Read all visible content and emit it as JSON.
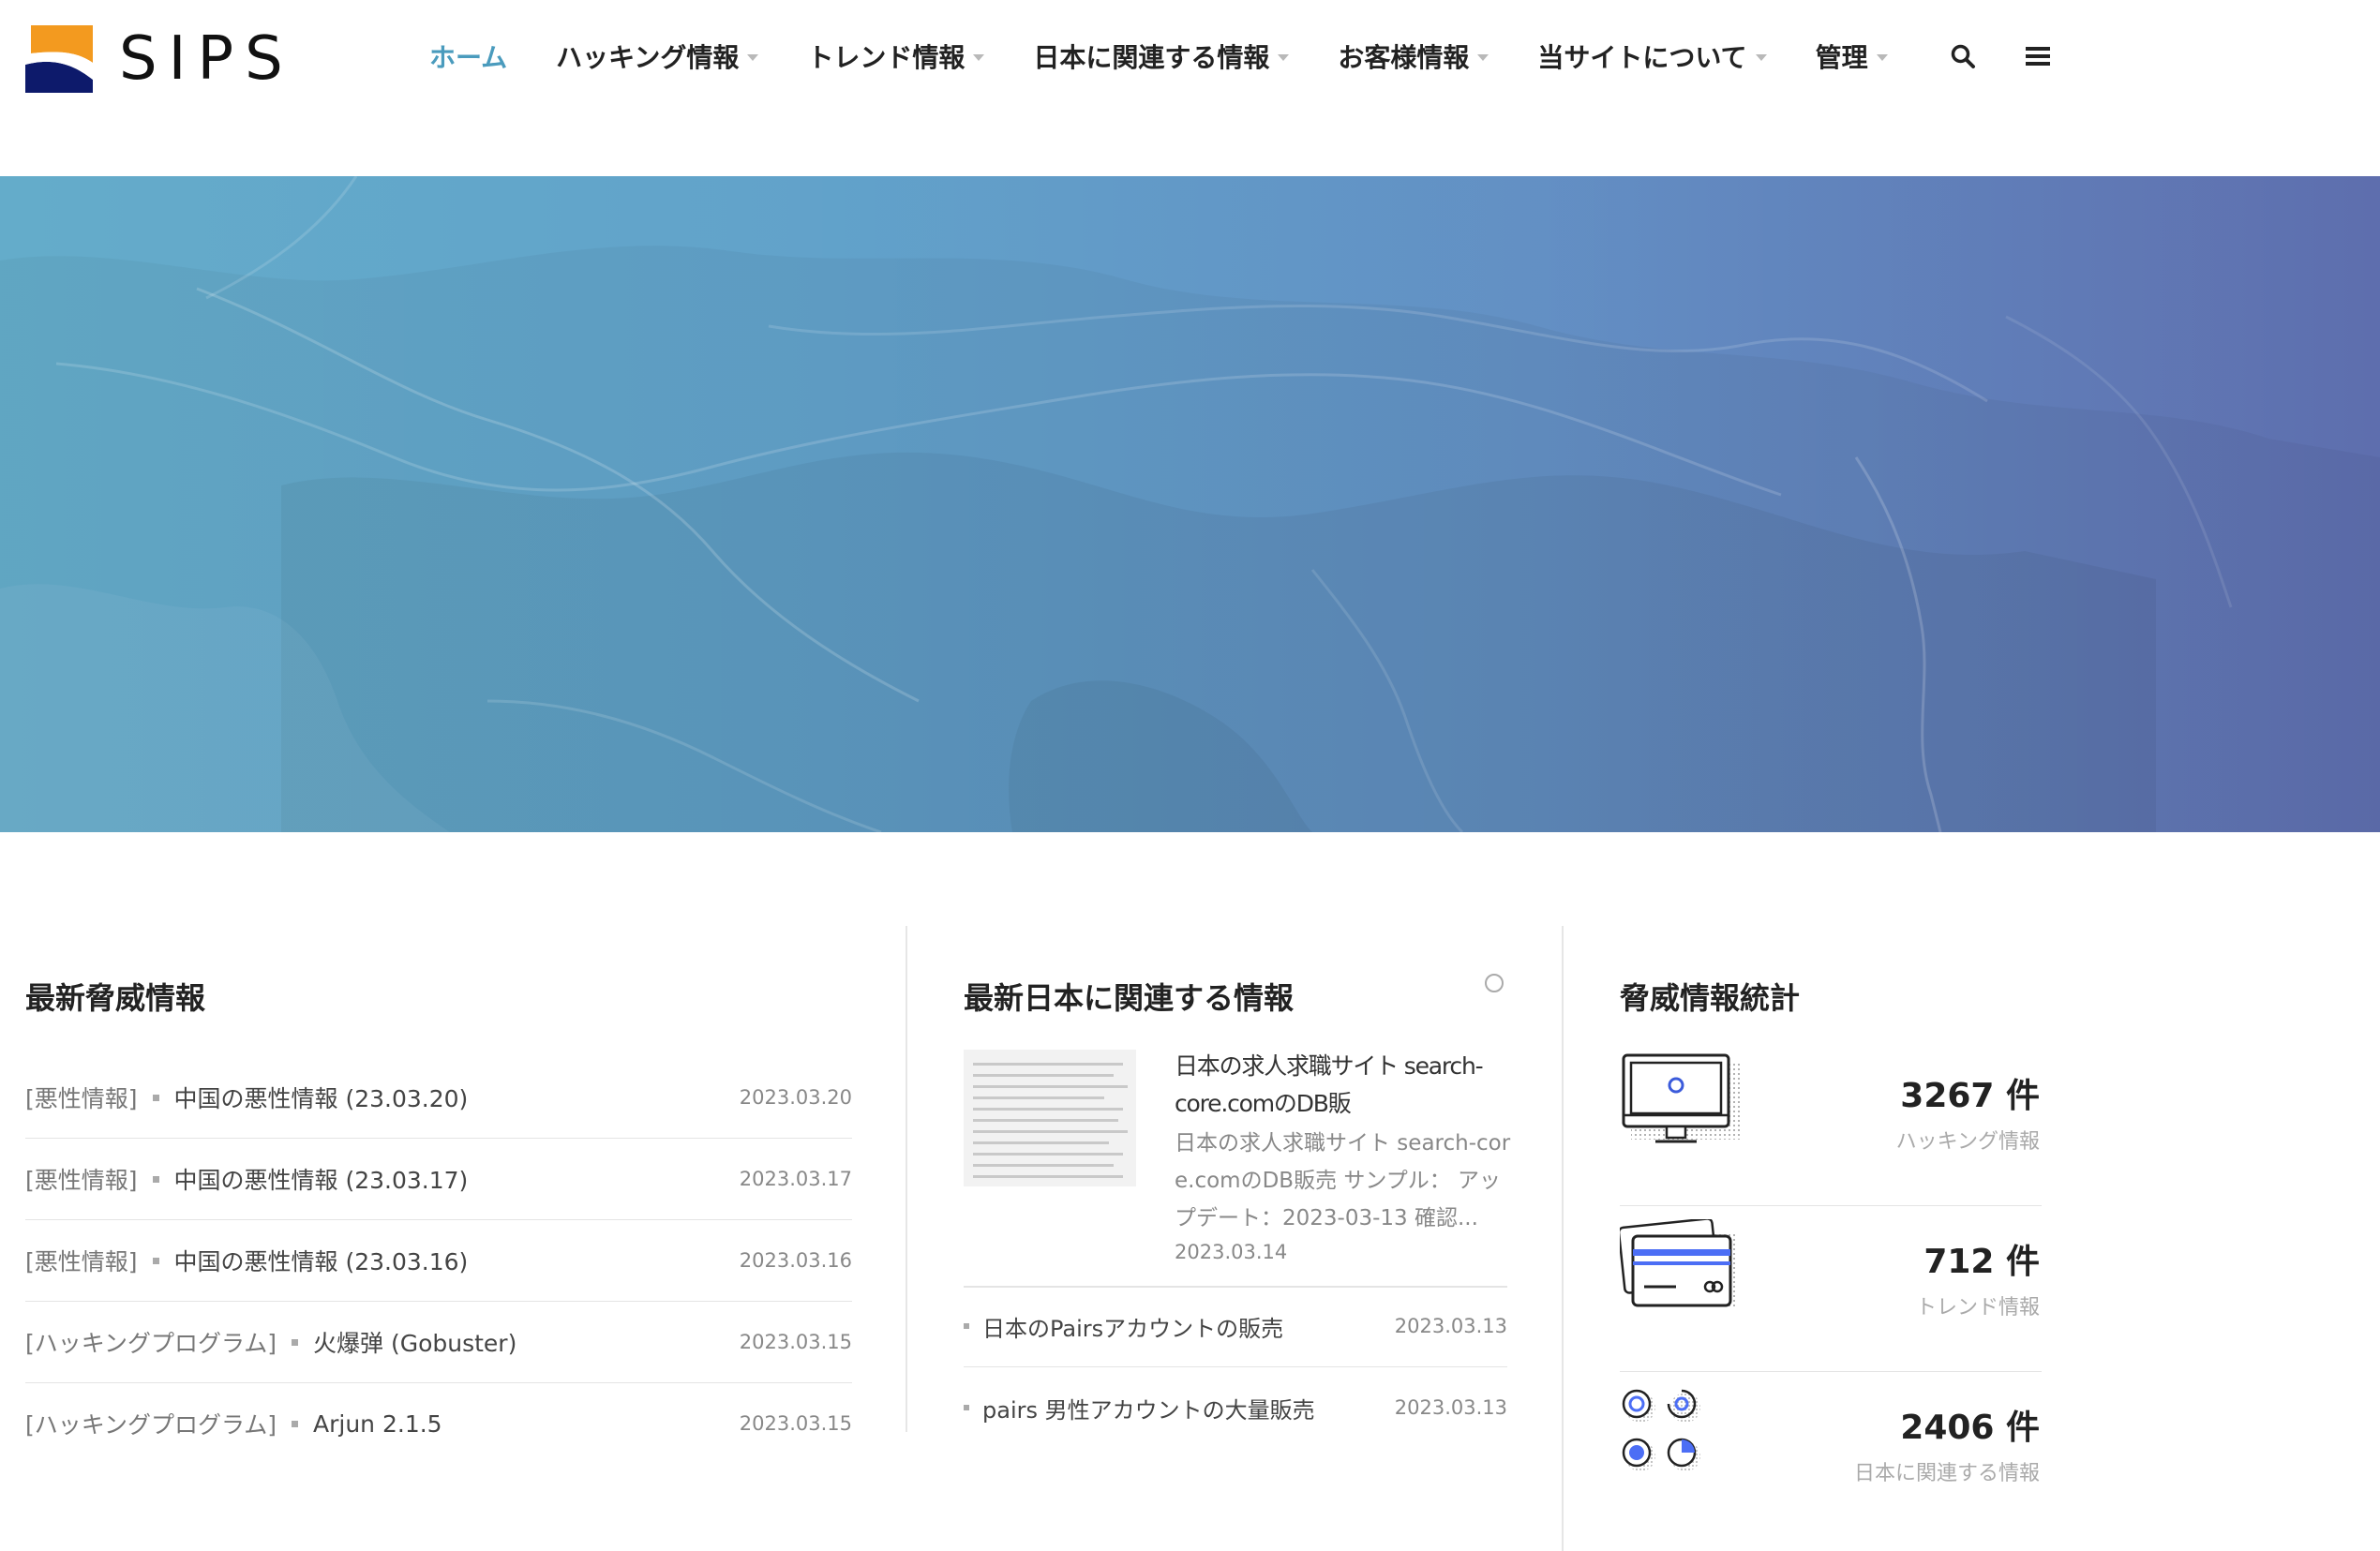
{
  "brand": {
    "name": "SIPS",
    "colors": {
      "orange": "#f39a1f",
      "navy": "#0d1a6b",
      "accent": "#4a9bbd"
    }
  },
  "nav": {
    "items": [
      {
        "label": "ホーム",
        "active": true,
        "dropdown": false
      },
      {
        "label": "ハッキング情報",
        "active": false,
        "dropdown": true
      },
      {
        "label": "トレンド情報",
        "active": false,
        "dropdown": true
      },
      {
        "label": "日本に関連する情報",
        "active": false,
        "dropdown": true
      },
      {
        "label": "お客様情報",
        "active": false,
        "dropdown": true
      },
      {
        "label": "当サイトについて",
        "active": false,
        "dropdown": true
      },
      {
        "label": "管理",
        "active": false,
        "dropdown": true
      }
    ],
    "icons": [
      "search-icon",
      "menu-icon"
    ]
  },
  "threats": {
    "title": "最新脅威情報",
    "items": [
      {
        "category": "[悪性情報]",
        "title": "中国の悪性情報 (23.03.20)",
        "date": "2023.03.20"
      },
      {
        "category": "[悪性情報]",
        "title": "中国の悪性情報 (23.03.17)",
        "date": "2023.03.17"
      },
      {
        "category": "[悪性情報]",
        "title": "中国の悪性情報 (23.03.16)",
        "date": "2023.03.16"
      },
      {
        "category": "[ハッキングプログラム]",
        "title": "火爆弹 (Gobuster)",
        "date": "2023.03.15"
      },
      {
        "category": "[ハッキングプログラム]",
        "title": "Arjun 2.1.5",
        "date": "2023.03.15"
      }
    ]
  },
  "japan": {
    "title": "最新日本に関連する情報",
    "featured": {
      "title": "日本の求人求職サイト search-core.comのDB販",
      "excerpt": "日本の求人求職サイト search-core.comのDB販売 サンプル： アップデート：2023-03-13 確認...",
      "date": "2023.03.14"
    },
    "items": [
      {
        "title": "日本のPairsアカウントの販売",
        "date": "2023.03.13"
      },
      {
        "title": "pairs 男性アカウントの大量販売",
        "date": "2023.03.13"
      }
    ]
  },
  "stats": {
    "title": "脅威情報統計",
    "items": [
      {
        "count": "3267 件",
        "label": "ハッキング情報",
        "icon": "monitor-icon"
      },
      {
        "count": "712 件",
        "label": "トレンド情報",
        "icon": "credit-card-icon"
      },
      {
        "count": "2406 件",
        "label": "日本に関連する情報",
        "icon": "analytics-icon"
      }
    ]
  }
}
